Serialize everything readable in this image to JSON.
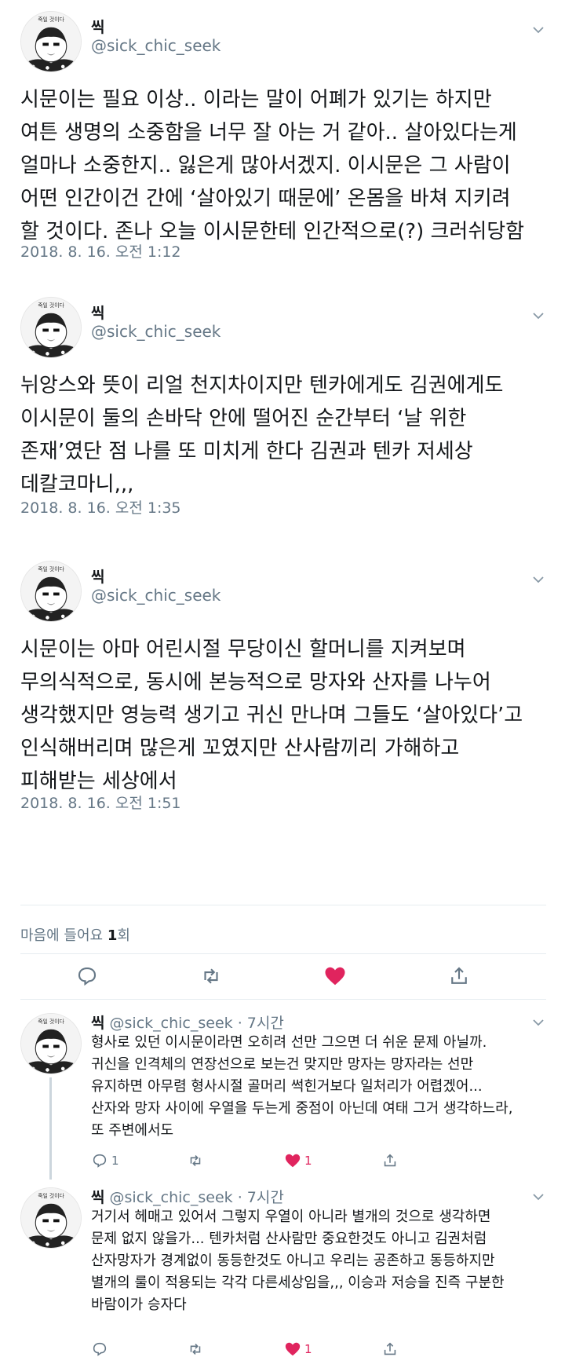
{
  "tweets": [
    {
      "name": "씩",
      "handle": "@sick_chic_seek",
      "text": "시문이는 필요 이상.. 이라는 말이 어폐가 있기는 하지만\n여튼 생명의 소중함을 너무 잘 아는 거 같아.. 살아있다는게\n얼마나 소중한지.. 잃은게 많아서겠지. 이시문은 그 사람이\n어떤 인간이건 간에 ‘살아있기 때문에’ 온몸을 바쳐 지키려\n할 것이다. 존나 오늘 이시문한테 인간적으로(?) 크러쉬당함",
      "time": "2018. 8. 16. 오전 1:12"
    },
    {
      "name": "씩",
      "handle": "@sick_chic_seek",
      "text": "뉘앙스와 뜻이 리얼 천지차이지만 텐카에게도 김권에게도\n이시문이 둘의 손바닥 안에 떨어진 순간부터 ‘날 위한\n존재’였단 점 나를 또 미치게 한다 김권과 텐카 저세상\n데칼코마니,,,",
      "time": "2018. 8. 16. 오전 1:35"
    },
    {
      "name": "씩",
      "handle": "@sick_chic_seek",
      "text": "시문이는 아마 어린시절 무당이신 할머니를 지켜보며\n무의식적으로, 동시에 본능적으로 망자와 산자를 나누어\n생각했지만 영능력 생기고 귀신 만나며 그들도 ‘살아있다’고\n인식해버리며 많은게 꼬였지만 산사람끼리 가해하고\n피해받는 세상에서",
      "time": "2018. 8. 16. 오전 1:51"
    }
  ],
  "likes_bar": {
    "label": "마음에 들어요",
    "count": "1",
    "suffix": "회"
  },
  "replies": [
    {
      "name": "씩",
      "handle": "@sick_chic_seek",
      "age": "· 7시간",
      "text": "형사로 있던 이시문이라면 오히려 선만 그으면 더 쉬운 문제 아닐까.\n귀신을 인격체의 연장선으로 보는건 맞지만 망자는 망자라는 선만\n유지하면 아무렴 형사시절 골머리 썩힌거보다 일처리가 어렵겠어...\n산자와 망자 사이에 우열을 두는게 중점이 아닌데 여태 그거 생각하느라,\n또 주변에서도",
      "reply_count": "1",
      "like_count": "1"
    },
    {
      "name": "씩",
      "handle": "@sick_chic_seek",
      "age": "· 7시간",
      "text": "거기서 헤매고 있어서 그렇지 우열이 아니라 별개의 것으로 생각하면\n문제 없지 않을가... 텐카처럼 산사람만 중요한것도 아니고 김권처럼\n산자망자가 경계없이 동등한것도 아니고 우리는 공존하고 동등하지만\n별개의 룰이 적용되는 각각 다른세상임을,,, 이승과 저승을 진즉 구분한\n바람이가 승자다",
      "like_count": "1"
    }
  ],
  "avatar_text": "죽일 것이다",
  "colors": {
    "like_red": "#e0245e",
    "secondary": "#657786",
    "icon": "#657786"
  }
}
